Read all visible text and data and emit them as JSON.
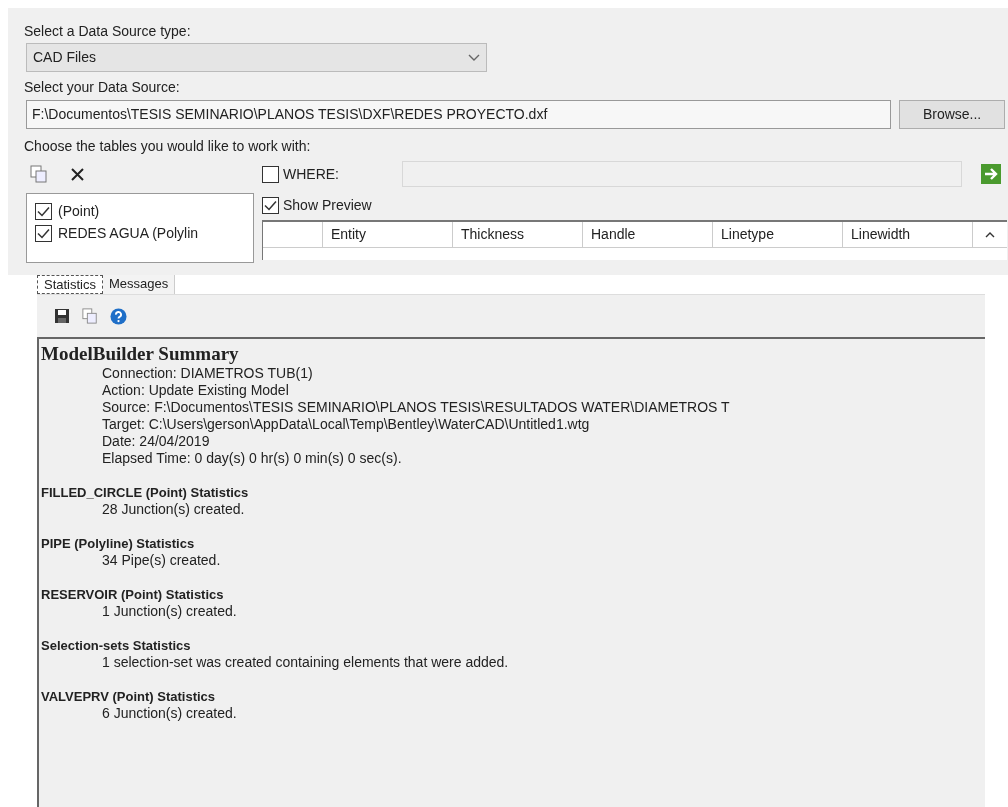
{
  "data_source_type": {
    "label": "Select a Data Source type:",
    "value": "CAD Files"
  },
  "data_source": {
    "label": "Select your Data Source:",
    "value": "F:\\Documentos\\TESIS SEMINARIO\\PLANOS TESIS\\DXF\\REDES PROYECTO.dxf",
    "browse_button": "Browse..."
  },
  "tables": {
    "label": "Choose the tables you would like to work with:",
    "items": [
      {
        "label": "(Point)",
        "checked": true
      },
      {
        "label": "REDES AGUA (Polylin",
        "checked": true
      }
    ]
  },
  "where": {
    "label": "WHERE:",
    "checked": false
  },
  "show_preview": {
    "label": "Show Preview",
    "checked": true
  },
  "preview_table": {
    "columns": [
      "Entity",
      "Thickness",
      "Handle",
      "Linetype",
      "Linewidth"
    ]
  },
  "tabs": [
    {
      "label": "Statistics",
      "selected": true
    },
    {
      "label": "Messages",
      "selected": false
    }
  ],
  "summary": {
    "title": "ModelBuilder Summary",
    "lines": [
      "Connection: DIAMETROS TUB(1)",
      "Action: Update Existing Model",
      "Source: F:\\Documentos\\TESIS SEMINARIO\\PLANOS TESIS\\RESULTADOS WATER\\DIAMETROS T",
      "Target: C:\\Users\\gerson\\AppData\\Local\\Temp\\Bentley\\WaterCAD\\Untitled1.wtg",
      "Date: 24/04/2019",
      "Elapsed Time: 0 day(s) 0 hr(s) 0 min(s) 0 sec(s)."
    ],
    "sections": [
      {
        "heading": "FILLED_CIRCLE (Point) Statistics",
        "lines": [
          "28 Junction(s) created."
        ]
      },
      {
        "heading": "PIPE (Polyline) Statistics",
        "lines": [
          "34 Pipe(s) created."
        ]
      },
      {
        "heading": "RESERVOIR (Point) Statistics",
        "lines": [
          "1 Junction(s) created."
        ]
      },
      {
        "heading": "Selection-sets Statistics",
        "lines": [
          "1 selection-set was created containing elements that were added."
        ]
      },
      {
        "heading": "VALVEPRV (Point) Statistics",
        "lines": [
          "6 Junction(s) created."
        ]
      }
    ]
  }
}
